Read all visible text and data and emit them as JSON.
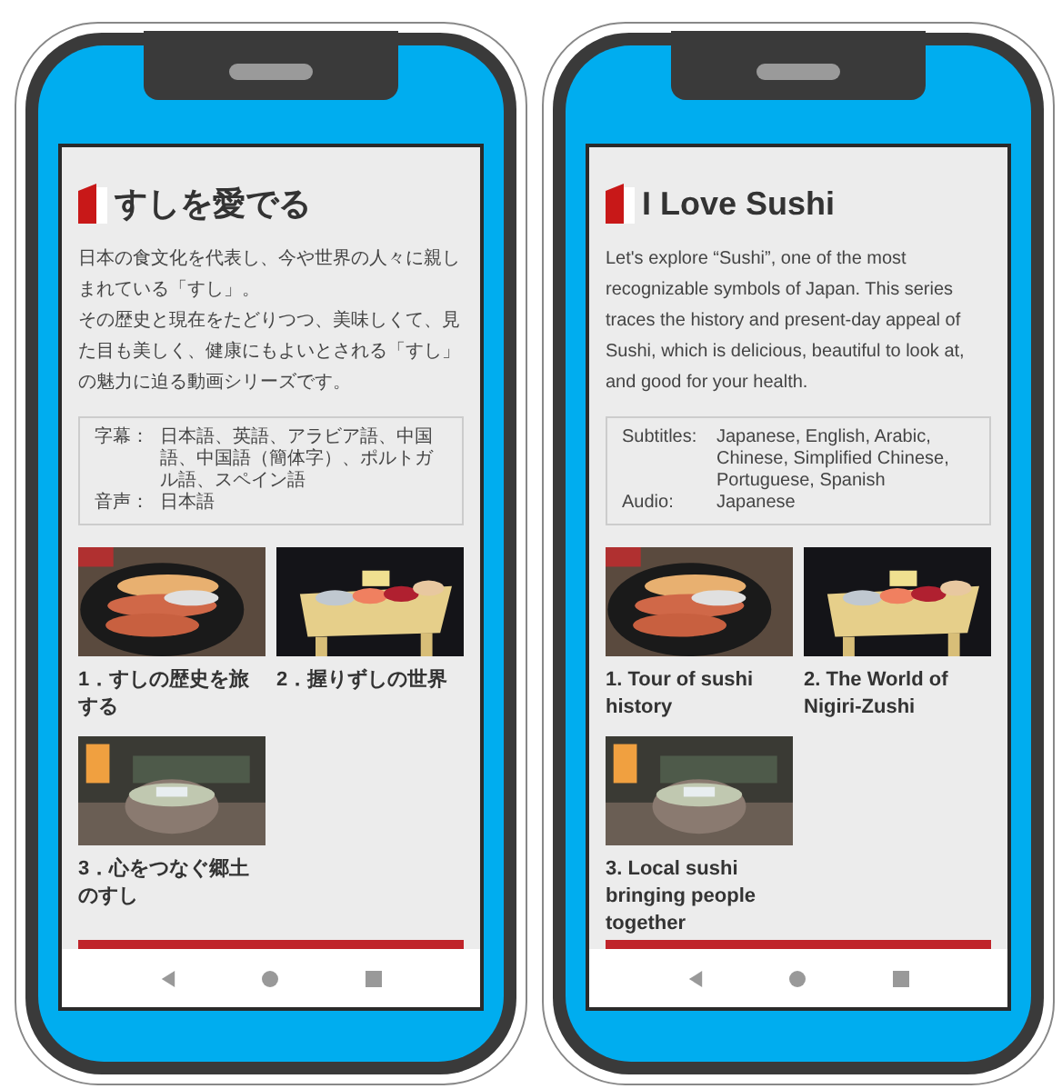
{
  "phones": [
    {
      "title": "すしを愛でる",
      "description": [
        "日本の食文化を代表し、今や世界の人々に親しまれている「すし」。",
        "その歴史と現在をたどりつつ、美味しくて、見た目も美しく、健康にもよいとされる「すし」の魅力に迫る動画シリーズです。"
      ],
      "info": [
        {
          "label": "字幕：",
          "value": "日本語、英語、アラビア語、中国語、中国語（簡体字）、ポルトガル語、スペイン語"
        },
        {
          "label": "音声：",
          "value": "日本語"
        }
      ],
      "videos": [
        {
          "title": "1．すしの歴史を旅する",
          "kind": "platter"
        },
        {
          "title": "2．握りずしの世界",
          "kind": "board"
        },
        {
          "title": "3．心をつなぐ郷土のすし",
          "kind": "bowl"
        }
      ]
    },
    {
      "title": "I Love Sushi",
      "description": [
        "Let's explore “Sushi”, one of the most recognizable symbols of Japan. This series traces the history and present-day appeal of Sushi, which is delicious, beautiful to look at, and good for your health."
      ],
      "info": [
        {
          "label": "Subtitles:",
          "value": "Japanese, English, Arabic, Chinese, Simplified Chinese, Portuguese, Spanish"
        },
        {
          "label": "Audio:",
          "value": "Japanese"
        }
      ],
      "videos": [
        {
          "title": "1. Tour of sushi history",
          "kind": "platter"
        },
        {
          "title": "2. The World of Nigiri-Zushi",
          "kind": "board"
        },
        {
          "title": "3. Local sushi bringing people together",
          "kind": "bowl"
        }
      ]
    }
  ]
}
